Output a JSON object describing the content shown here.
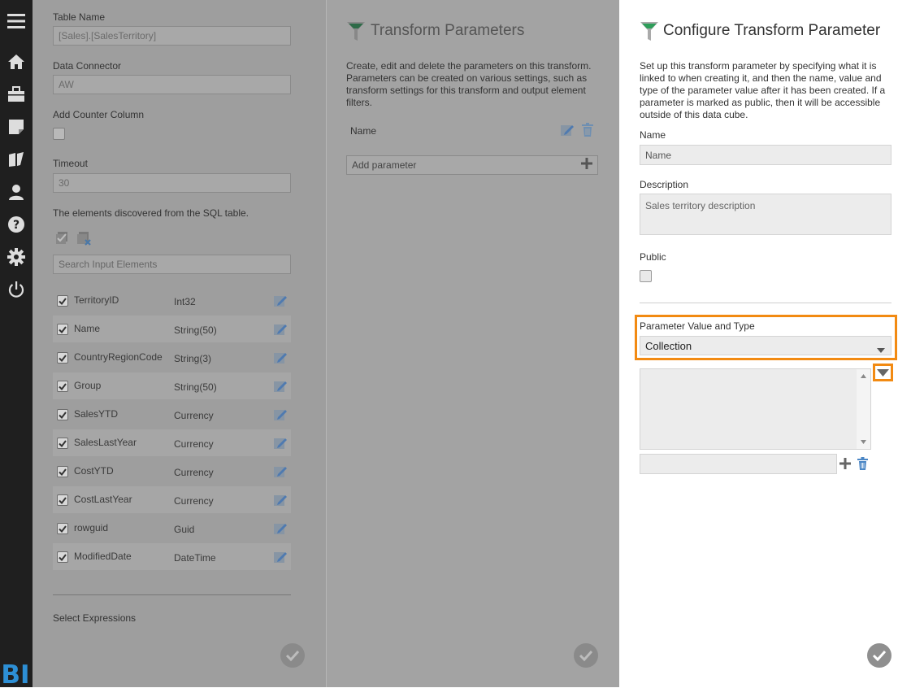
{
  "sidebar": {
    "items": [
      {
        "icon": "menu-icon"
      },
      {
        "icon": "home-icon"
      },
      {
        "icon": "briefcase-icon"
      },
      {
        "icon": "note-icon"
      },
      {
        "icon": "book-icon"
      },
      {
        "icon": "user-icon"
      },
      {
        "icon": "help-icon"
      },
      {
        "icon": "gear-icon"
      },
      {
        "icon": "power-icon"
      }
    ],
    "logo_text": "BI"
  },
  "table_panel": {
    "table_name_label": "Table Name",
    "table_name_value": "[Sales].[SalesTerritory]",
    "data_connector_label": "Data Connector",
    "data_connector_value": "AW",
    "add_counter_label": "Add Counter Column",
    "timeout_label": "Timeout",
    "timeout_value": "30",
    "elements_label": "The elements discovered from the SQL table.",
    "search_placeholder": "Search Input Elements",
    "elements": [
      {
        "name": "TerritoryID",
        "type": "Int32"
      },
      {
        "name": "Name",
        "type": "String(50)"
      },
      {
        "name": "CountryRegionCode",
        "type": "String(3)"
      },
      {
        "name": "Group",
        "type": "String(50)"
      },
      {
        "name": "SalesYTD",
        "type": "Currency"
      },
      {
        "name": "SalesLastYear",
        "type": "Currency"
      },
      {
        "name": "CostYTD",
        "type": "Currency"
      },
      {
        "name": "CostLastYear",
        "type": "Currency"
      },
      {
        "name": "rowguid",
        "type": "Guid"
      },
      {
        "name": "ModifiedDate",
        "type": "DateTime"
      }
    ],
    "select_expressions_label": "Select Expressions"
  },
  "params_panel": {
    "title": "Transform Parameters",
    "description": "Create, edit and delete the parameters on this transform. Parameters can be created on various settings, such as transform settings for this transform and output element filters.",
    "param_name": "Name",
    "add_parameter_label": "Add parameter"
  },
  "config_panel": {
    "title": "Configure Transform Parameter",
    "description": "Set up this transform parameter by specifying what it is linked to when creating it, and then the name, value and type of the parameter value after it has been created. If a parameter is marked as public, then it will be accessible outside of this data cube.",
    "name_label": "Name",
    "name_value": "Name",
    "description_label": "Description",
    "description_placeholder": "Sales territory description",
    "public_label": "Public",
    "value_type_label": "Parameter Value and Type",
    "value_type_selected": "Collection"
  },
  "colors": {
    "highlight": "#f28a12",
    "sidebar_bg": "#1f1f1f",
    "funnel_green": "#2e9e5a",
    "logo_blue": "#2d8fd5"
  }
}
